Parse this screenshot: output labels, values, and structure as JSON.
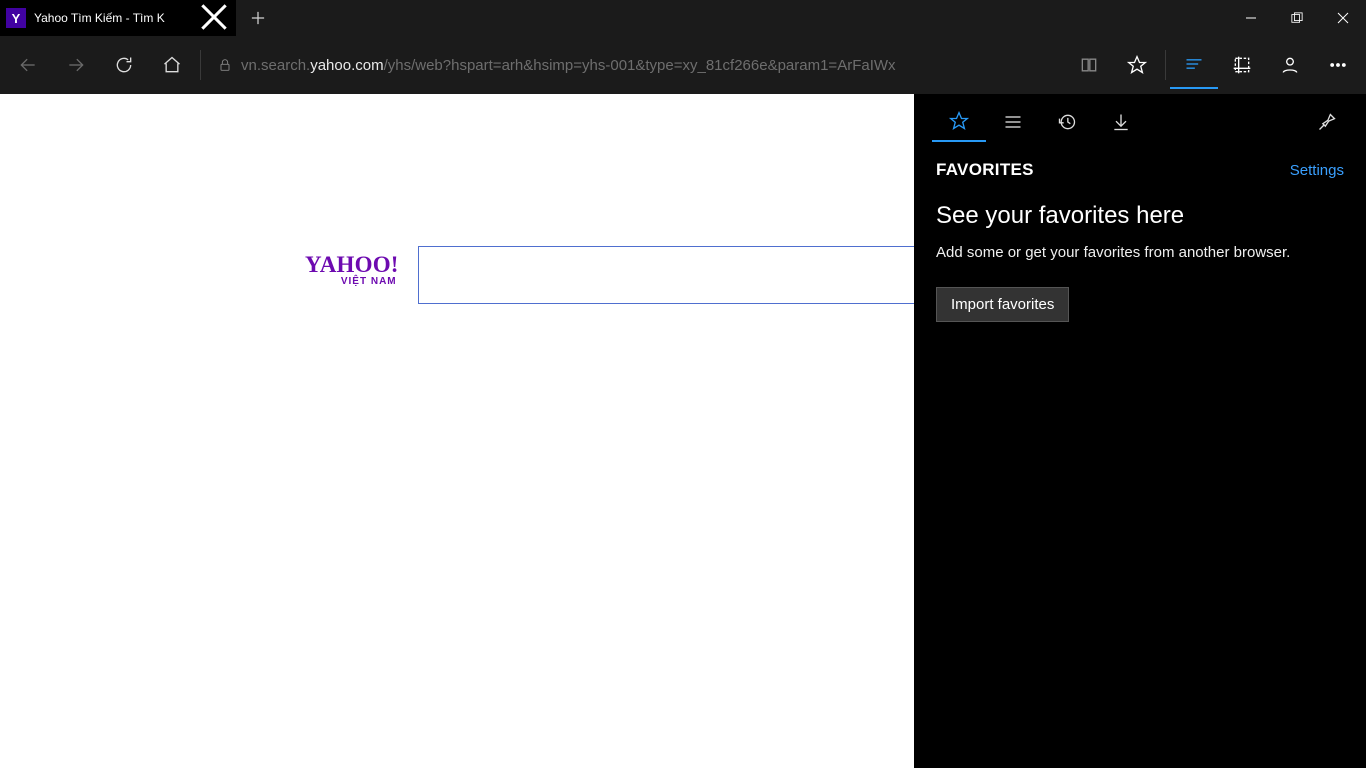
{
  "tab": {
    "favicon_letter": "Y",
    "title": "Yahoo Tìm Kiếm - Tìm K"
  },
  "url": {
    "prefix": "vn.search.",
    "domain": "yahoo.com",
    "path": "/yhs/web?hspart=arh&hsimp=yhs-001&type=xy_81cf266e&param1=ArFaIWx"
  },
  "yahoo": {
    "logo_main": "YAHOO!",
    "logo_sub": "VIỆT NAM"
  },
  "hub": {
    "title": "FAVORITES",
    "settings": "Settings",
    "headline": "See your favorites here",
    "subtext": "Add some or get your favorites from another browser.",
    "import": "Import favorites"
  }
}
